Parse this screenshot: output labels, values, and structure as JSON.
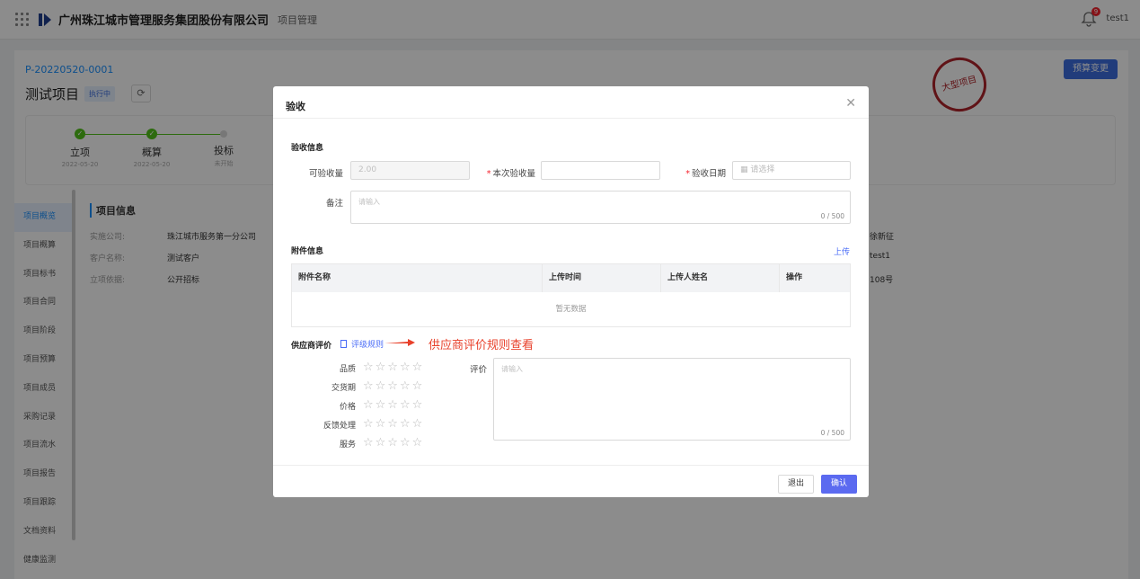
{
  "topbar": {
    "company": "广州珠江城市管理服务集团股份有限公司",
    "module": "项目管理",
    "username": "test1",
    "badge": "9"
  },
  "project": {
    "code": "P-20220520-0001",
    "name": "测试项目",
    "status": "执行中",
    "budget_change": "预算变更",
    "seal": "大型项目"
  },
  "steps": [
    {
      "label": "立项",
      "date": "2022-05-20"
    },
    {
      "label": "概算",
      "date": "2022-05-20"
    },
    {
      "label": "投标",
      "date": "未开始"
    }
  ],
  "side_menu": [
    "项目概览",
    "项目概算",
    "项目标书",
    "项目合同",
    "项目阶段",
    "项目预算",
    "项目成员",
    "采购记录",
    "项目流水",
    "项目报告",
    "项目跟踪",
    "文档资料",
    "健康监测"
  ],
  "info": {
    "title": "项目信息",
    "rows": [
      {
        "k": "实施公司:",
        "v": "珠江城市服务第一分公司"
      },
      {
        "k": "客户名称:",
        "v": "测试客户"
      },
      {
        "k": "立项依据:",
        "v": "公开招标"
      }
    ],
    "right": [
      "徐新征",
      "test1",
      "108号"
    ]
  },
  "modal": {
    "title": "验收",
    "section_accept": "验收信息",
    "acceptable_qty_label": "可验收量",
    "acceptable_qty_value": "2.00",
    "this_qty_label": "本次验收量",
    "date_label": "验收日期",
    "date_placeholder": "请选择",
    "remark_label": "备注",
    "remark_placeholder": "请输入",
    "remark_count": "0 / 500",
    "section_attach": "附件信息",
    "upload": "上传",
    "table_headers": [
      "附件名称",
      "上传时间",
      "上传人姓名",
      "操作"
    ],
    "table_empty": "暂无数据",
    "section_rating": "供应商评价",
    "rule_link": "评级规则",
    "annotation": "供应商评价规则查看",
    "ratings": [
      "品质",
      "交货期",
      "价格",
      "反馈处理",
      "服务"
    ],
    "stars": "☆☆☆☆☆",
    "comment_label": "评价",
    "comment_placeholder": "请输入",
    "comment_count": "0 / 500",
    "cancel": "退出",
    "ok": "确认"
  }
}
